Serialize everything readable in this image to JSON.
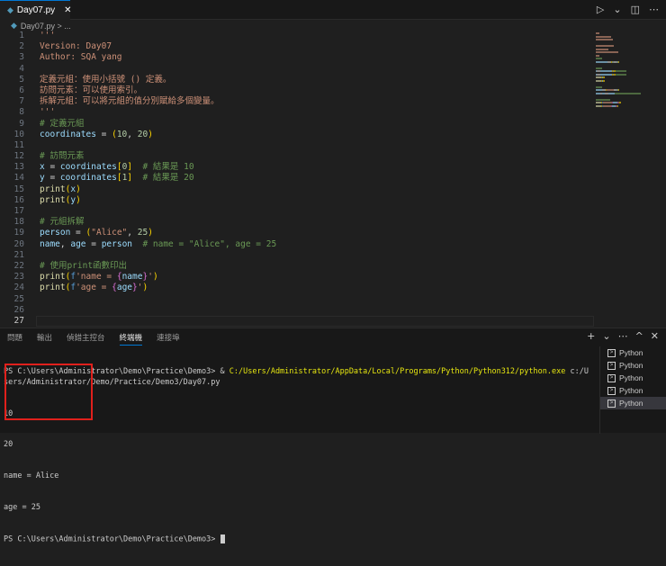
{
  "tab": {
    "name": "Day07.py",
    "close": "✕"
  },
  "breadcrumb": {
    "file": "Day07.py",
    "sep": ">",
    "more": "..."
  },
  "actions": {
    "run": "▷",
    "run_menu": "⌄",
    "split": "◫",
    "more": "⋯"
  },
  "code": [
    [
      [
        "'''",
        "s"
      ]
    ],
    [
      [
        "Version: Day07",
        "s"
      ]
    ],
    [
      [
        "Author: SQA yang",
        "s"
      ]
    ],
    [],
    [
      [
        "定義元組：使用小括號 () 定義。",
        "s"
      ]
    ],
    [
      [
        "訪問元素：可以使用索引。",
        "s"
      ]
    ],
    [
      [
        "拆解元組：可以將元組的值分別賦給多個變量。",
        "s"
      ]
    ],
    [
      [
        "'''",
        "s"
      ]
    ],
    [
      [
        "# 定義元組",
        "c"
      ]
    ],
    [
      [
        "coordinates",
        "v"
      ],
      [
        " = ",
        "o"
      ],
      [
        "(",
        "b"
      ],
      [
        "10",
        "n"
      ],
      [
        ", ",
        "o"
      ],
      [
        "20",
        "n"
      ],
      [
        ")",
        "b"
      ]
    ],
    [],
    [
      [
        "# 訪問元素",
        "c"
      ]
    ],
    [
      [
        "x",
        "v"
      ],
      [
        " = ",
        "o"
      ],
      [
        "coordinates",
        "v"
      ],
      [
        "[",
        "b"
      ],
      [
        "0",
        "n"
      ],
      [
        "]",
        "b"
      ],
      [
        "  # 結果是 10",
        "c"
      ]
    ],
    [
      [
        "y",
        "v"
      ],
      [
        " = ",
        "o"
      ],
      [
        "coordinates",
        "v"
      ],
      [
        "[",
        "b"
      ],
      [
        "1",
        "n"
      ],
      [
        "]",
        "b"
      ],
      [
        "  # 結果是 20",
        "c"
      ]
    ],
    [
      [
        "print",
        "f"
      ],
      [
        "(",
        "b"
      ],
      [
        "x",
        "v"
      ],
      [
        ")",
        "b"
      ]
    ],
    [
      [
        "print",
        "f"
      ],
      [
        "(",
        "b"
      ],
      [
        "y",
        "v"
      ],
      [
        ")",
        "b"
      ]
    ],
    [],
    [
      [
        "# 元組拆解",
        "c"
      ]
    ],
    [
      [
        "person",
        "v"
      ],
      [
        " = ",
        "o"
      ],
      [
        "(",
        "b"
      ],
      [
        "\"Alice\"",
        "s"
      ],
      [
        ", ",
        "o"
      ],
      [
        "25",
        "n"
      ],
      [
        ")",
        "b"
      ]
    ],
    [
      [
        "name",
        "v"
      ],
      [
        ", ",
        "o"
      ],
      [
        "age",
        "v"
      ],
      [
        " = ",
        "o"
      ],
      [
        "person",
        "v"
      ],
      [
        "  # name = \"Alice\", age = 25",
        "c"
      ]
    ],
    [],
    [
      [
        "# 使用print函數印出",
        "c"
      ]
    ],
    [
      [
        "print",
        "f"
      ],
      [
        "(",
        "b"
      ],
      [
        "f",
        "k"
      ],
      [
        "'name = ",
        "s"
      ],
      [
        "{",
        "p"
      ],
      [
        "name",
        "v"
      ],
      [
        "}",
        "p"
      ],
      [
        "'",
        "s"
      ],
      [
        ")",
        "b"
      ]
    ],
    [
      [
        "print",
        "f"
      ],
      [
        "(",
        "b"
      ],
      [
        "f",
        "k"
      ],
      [
        "'age = ",
        "s"
      ],
      [
        "{",
        "p"
      ],
      [
        "age",
        "v"
      ],
      [
        "}",
        "p"
      ],
      [
        "'",
        "s"
      ],
      [
        ")",
        "b"
      ]
    ],
    [],
    [],
    []
  ],
  "panel": {
    "tabs": [
      "問題",
      "輸出",
      "偵錯主控台",
      "終端機",
      "連接埠"
    ],
    "active_tab": 3,
    "actions": {
      "add": "+",
      "add_menu": "⌄",
      "more": "⋯",
      "maximize": "^",
      "close": "✕"
    }
  },
  "terminal": {
    "cmd_prompt": "PS C:\\Users\\Administrator\\Demo\\Practice\\Demo3> & ",
    "cmd_exe": "C:/Users/Administrator/AppData/Local/Programs/Python/Python312/python.exe",
    "cmd_arg": " c:/Users/Administrator/Demo/Practice/Demo3/Day07.py",
    "output": [
      "10",
      "20",
      "name = Alice",
      "age = 25"
    ],
    "prompt": "PS C:\\Users\\Administrator\\Demo\\Practice\\Demo3> "
  },
  "terminals": [
    "Python",
    "Python",
    "Python",
    "Python",
    "Python"
  ],
  "selected_terminal": 4
}
